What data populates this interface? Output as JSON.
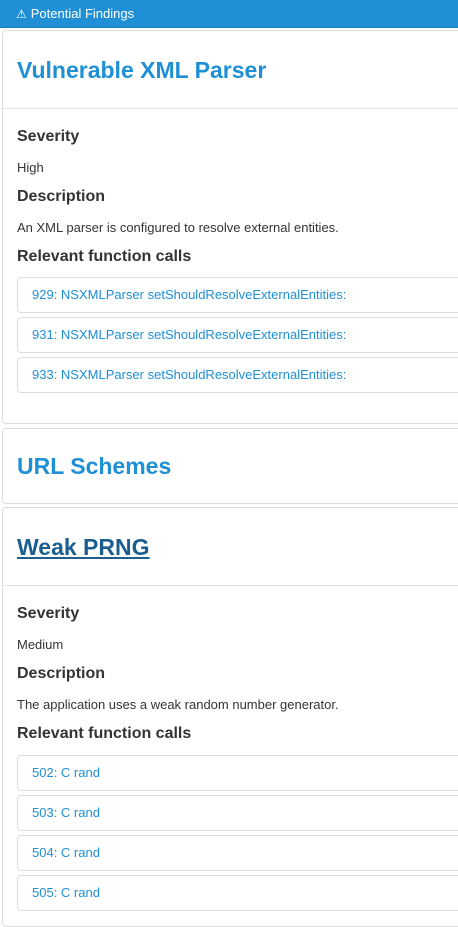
{
  "header": {
    "icon": "warning-triangle-icon",
    "title": "Potential Findings"
  },
  "findings": [
    {
      "title": "Vulnerable XML Parser",
      "severity_label": "Severity",
      "severity": "High",
      "description_label": "Description",
      "description": "An XML parser is configured to resolve external entities.",
      "calls_label": "Relevant function calls",
      "calls": [
        "929: NSXMLParser setShouldResolveExternalEntities:",
        "931: NSXMLParser setShouldResolveExternalEntities:",
        "933: NSXMLParser setShouldResolveExternalEntities:"
      ]
    },
    {
      "title": "URL Schemes"
    },
    {
      "title": "Weak PRNG",
      "severity_label": "Severity",
      "severity": "Medium",
      "description_label": "Description",
      "description": "The application uses a weak random number generator.",
      "calls_label": "Relevant function calls",
      "calls": [
        "502: C rand",
        "503: C rand",
        "504: C rand",
        "505: C rand"
      ]
    }
  ],
  "colors": {
    "accent": "#1f8fd6",
    "visited_link": "#1c5f8e",
    "text": "#333333",
    "border": "#dddddd"
  }
}
